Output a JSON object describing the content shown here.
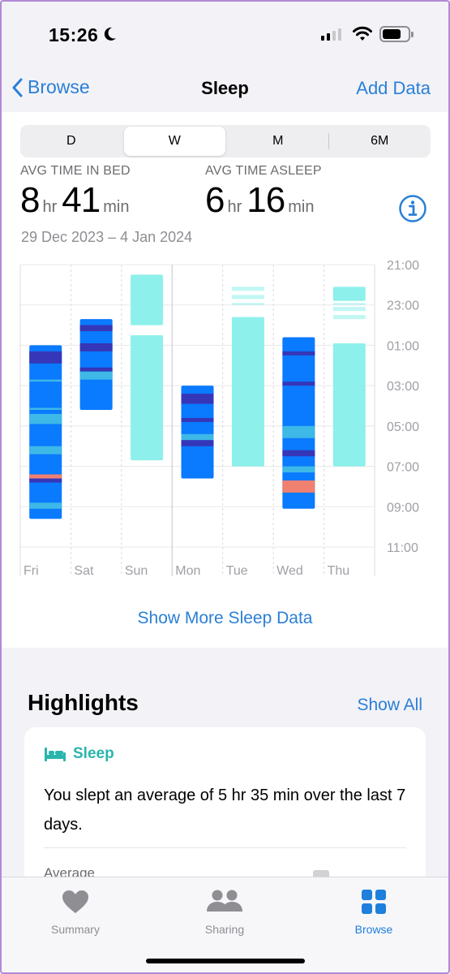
{
  "status": {
    "time": "15:26"
  },
  "nav": {
    "back": "Browse",
    "title": "Sleep",
    "action": "Add Data"
  },
  "segments": [
    {
      "label": "D",
      "active": false
    },
    {
      "label": "W",
      "active": true
    },
    {
      "label": "M",
      "active": false
    },
    {
      "label": "6M",
      "active": false
    }
  ],
  "stats": {
    "in_bed": {
      "label": "AVG TIME IN BED",
      "hr": "8",
      "hr_unit": "hr",
      "min": "41",
      "min_unit": "min"
    },
    "asleep": {
      "label": "AVG TIME ASLEEP",
      "hr": "6",
      "hr_unit": "hr",
      "min": "16",
      "min_unit": "min"
    },
    "date_range": "29 Dec 2023 – 4 Jan 2024"
  },
  "show_more": "Show More Sleep Data",
  "highlights": {
    "title": "Highlights",
    "show_all": "Show All",
    "card": {
      "tag": "Sleep",
      "text": "You slept an average of 5 hr 35 min over the last 7 days.",
      "average_label": "Average"
    }
  },
  "tabs": [
    {
      "label": "Summary",
      "icon": "heart-icon",
      "active": false
    },
    {
      "label": "Sharing",
      "icon": "people-icon",
      "active": false
    },
    {
      "label": "Browse",
      "icon": "grid-icon",
      "active": true
    }
  ],
  "colors": {
    "accent": "#2b7fd6",
    "core": "#0a7aff",
    "deep": "#3636b8",
    "rem": "#3eb8e6",
    "awake": "#f08070",
    "in_bed": "#8ef0ea"
  },
  "chart_data": {
    "type": "range-bar",
    "categories": [
      "Fri",
      "Sat",
      "Sun",
      "Mon",
      "Tue",
      "Wed",
      "Thu"
    ],
    "y_ticks": [
      "21:00",
      "23:00",
      "01:00",
      "03:00",
      "05:00",
      "07:00",
      "09:00",
      "11:00"
    ],
    "ylim_hours_from_2100": [
      0,
      14
    ],
    "days": [
      {
        "day": "Fri",
        "kind": "stages",
        "start": 4.0,
        "end": 12.6,
        "bands": [
          [
            4.0,
            4.3,
            "core"
          ],
          [
            4.3,
            4.9,
            "deep"
          ],
          [
            4.9,
            5.7,
            "core"
          ],
          [
            5.7,
            5.8,
            "rem"
          ],
          [
            5.8,
            7.1,
            "core"
          ],
          [
            7.1,
            7.2,
            "rem"
          ],
          [
            7.2,
            7.4,
            "core"
          ],
          [
            7.4,
            7.9,
            "rem"
          ],
          [
            7.9,
            9.0,
            "core"
          ],
          [
            9.0,
            9.4,
            "rem"
          ],
          [
            9.4,
            10.4,
            "core"
          ],
          [
            10.4,
            10.6,
            "awake"
          ],
          [
            10.6,
            10.8,
            "deep"
          ],
          [
            10.8,
            11.8,
            "core"
          ],
          [
            11.8,
            12.1,
            "rem"
          ],
          [
            12.1,
            12.6,
            "core"
          ]
        ]
      },
      {
        "day": "Sat",
        "kind": "stages",
        "start": 2.7,
        "end": 7.2,
        "bands": [
          [
            2.7,
            3.0,
            "core"
          ],
          [
            3.0,
            3.3,
            "deep"
          ],
          [
            3.3,
            3.9,
            "core"
          ],
          [
            3.9,
            4.3,
            "deep"
          ],
          [
            4.3,
            5.1,
            "core"
          ],
          [
            5.1,
            5.3,
            "deep"
          ],
          [
            5.3,
            5.7,
            "rem"
          ],
          [
            5.7,
            7.2,
            "core"
          ]
        ]
      },
      {
        "day": "Sun",
        "kind": "in_bed",
        "segments": [
          [
            0.5,
            3.0
          ],
          [
            3.5,
            9.7
          ]
        ]
      },
      {
        "day": "Mon",
        "kind": "stages",
        "start": 6.0,
        "end": 10.6,
        "bands": [
          [
            6.0,
            6.4,
            "core"
          ],
          [
            6.4,
            6.9,
            "deep"
          ],
          [
            6.9,
            7.6,
            "core"
          ],
          [
            7.6,
            7.8,
            "deep"
          ],
          [
            7.8,
            8.4,
            "core"
          ],
          [
            8.4,
            8.7,
            "rem"
          ],
          [
            8.7,
            9.0,
            "deep"
          ],
          [
            9.0,
            9.8,
            "core"
          ],
          [
            9.8,
            10.6,
            "core"
          ]
        ]
      },
      {
        "day": "Tue",
        "kind": "in_bed",
        "segments": [
          [
            1.1,
            1.3
          ],
          [
            1.5,
            1.7
          ],
          [
            1.9,
            2.0
          ],
          [
            2.6,
            10.0
          ]
        ]
      },
      {
        "day": "Wed",
        "kind": "stages",
        "start": 3.6,
        "end": 12.1,
        "bands": [
          [
            3.6,
            4.3,
            "core"
          ],
          [
            4.3,
            4.5,
            "deep"
          ],
          [
            4.5,
            5.8,
            "core"
          ],
          [
            5.8,
            6.0,
            "deep"
          ],
          [
            6.0,
            8.0,
            "core"
          ],
          [
            8.0,
            8.6,
            "rem"
          ],
          [
            8.6,
            9.2,
            "core"
          ],
          [
            9.2,
            9.5,
            "deep"
          ],
          [
            9.5,
            10.0,
            "core"
          ],
          [
            10.0,
            10.3,
            "rem"
          ],
          [
            10.3,
            10.7,
            "core"
          ],
          [
            10.7,
            11.3,
            "awake"
          ],
          [
            11.3,
            12.1,
            "core"
          ]
        ]
      },
      {
        "day": "Thu",
        "kind": "in_bed",
        "segments": [
          [
            1.1,
            1.8
          ],
          [
            1.9,
            2.0
          ],
          [
            2.1,
            2.3
          ],
          [
            2.5,
            2.7
          ],
          [
            3.9,
            10.0
          ]
        ]
      }
    ]
  }
}
